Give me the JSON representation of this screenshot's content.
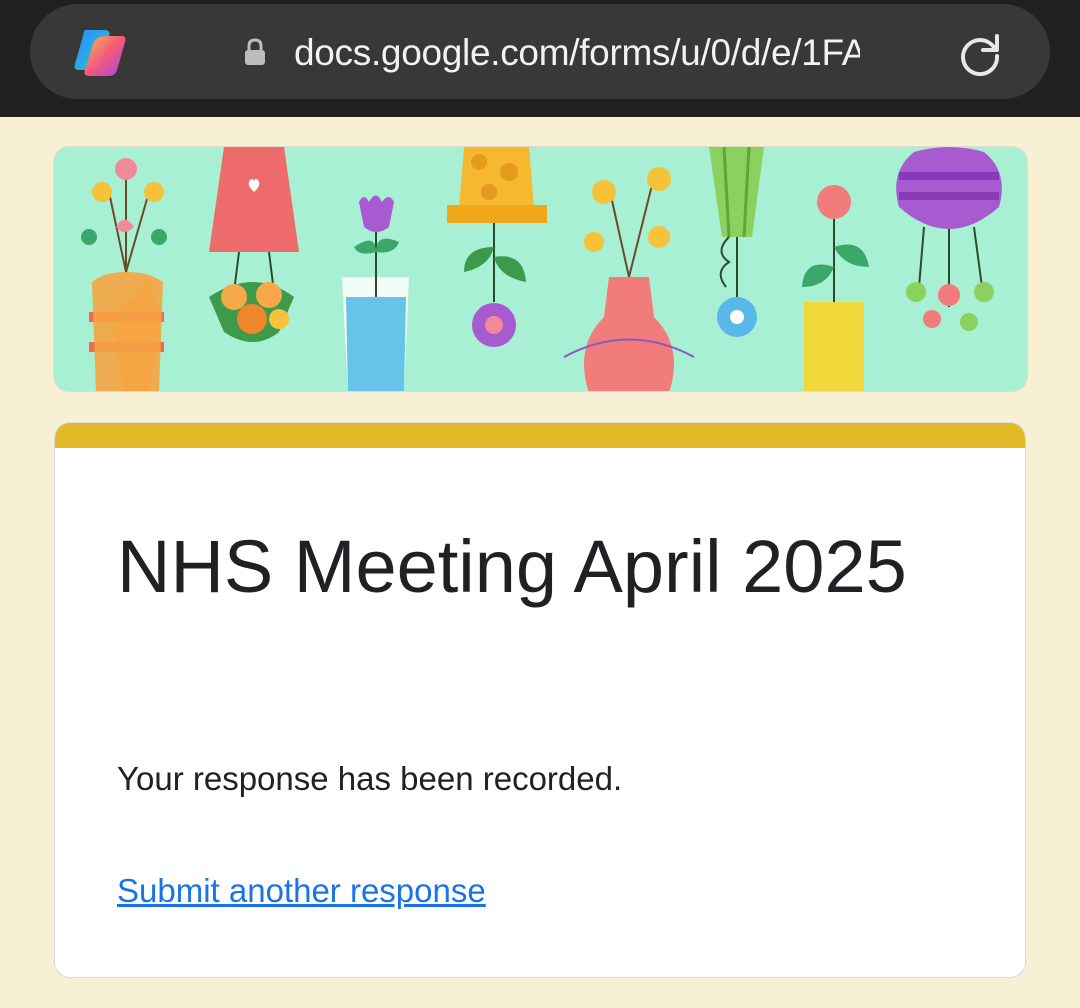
{
  "browser": {
    "url": "docs.google.com/forms/u/0/d/e/1FA",
    "app_logo_icon": "copilot-logo-icon",
    "lock_icon": "lock-icon",
    "reload_icon": "reload-icon"
  },
  "banner": {
    "description_icon": "flowers-in-vases-header-image"
  },
  "form": {
    "title": "NHS Meeting April 2025",
    "confirmation": "Your response has been recorded.",
    "submit_another_link": "Submit another response"
  },
  "colors": {
    "page_background": "#f8f0d5",
    "accent_bar": "#e2b927",
    "link": "#1a73e8",
    "banner_background": "#a8f0d4"
  }
}
